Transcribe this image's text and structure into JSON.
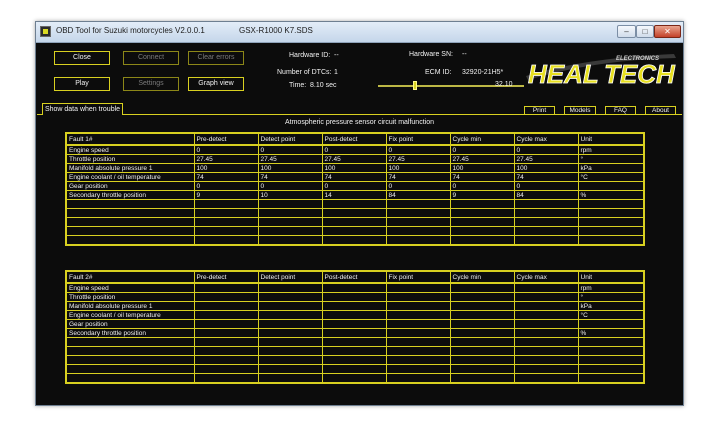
{
  "window": {
    "title": "OBD Tool for Suzuki motorcycles V2.0.0.1",
    "file": "GSX-R1000 K7.SDS",
    "minimize_glyph": "–",
    "maximize_glyph": "□",
    "close_glyph": "✕"
  },
  "toolbar": {
    "close": "Close",
    "connect": "Connect",
    "clear_errors": "Clear errors",
    "play": "Play",
    "settings": "Settings",
    "graph_view": "Graph view"
  },
  "info": {
    "hardware_id_label": "Hardware ID:",
    "hardware_id_value": "--",
    "hardware_sn_label": "Hardware SN:",
    "hardware_sn_value": "--",
    "dtc_label": "Number of DTCs:",
    "dtc_value": "1",
    "ecm_label": "ECM ID:",
    "ecm_value": "32920-21H5*",
    "time_label": "Time:",
    "time_value": "8.10 sec",
    "time_max": "32.10",
    "time_position": 0.25
  },
  "logo": {
    "text_heal": "HEAL",
    "text_tech": "TECH",
    "text_electronics": "ELECTRONICS",
    "color_main": "#e7e020"
  },
  "tabs": {
    "active": "Show data when trouble",
    "print": "Print",
    "models": "Models",
    "faq": "FAQ",
    "about": "About"
  },
  "heading": "Atmospheric pressure sensor circuit malfunction",
  "columns": [
    "Pre-detect",
    "Detect point",
    "Post-detect",
    "Fix point",
    "Cycle min",
    "Cycle max",
    "Unit"
  ],
  "fault1": {
    "label": "Fault 1#",
    "rows": [
      [
        "Engine speed",
        "0",
        "0",
        "0",
        "0",
        "0",
        "0",
        "rpm"
      ],
      [
        "Throttle position",
        "27.45",
        "27.45",
        "27.45",
        "27.45",
        "27.45",
        "27.45",
        "°"
      ],
      [
        "Manifold absolute pressure 1",
        "100",
        "100",
        "100",
        "100",
        "100",
        "100",
        "kPa"
      ],
      [
        "Engine coolant / oil temperature",
        "74",
        "74",
        "74",
        "74",
        "74",
        "74",
        "°C"
      ],
      [
        "Gear position",
        "0",
        "0",
        "0",
        "0",
        "0",
        "0",
        ""
      ],
      [
        "Secondary throttle position",
        "9",
        "10",
        "14",
        "84",
        "9",
        "84",
        "%"
      ],
      [
        "",
        "",
        "",
        "",
        "",
        "",
        "",
        ""
      ],
      [
        "",
        "",
        "",
        "",
        "",
        "",
        "",
        ""
      ],
      [
        "",
        "",
        "",
        "",
        "",
        "",
        "",
        ""
      ],
      [
        "",
        "",
        "",
        "",
        "",
        "",
        "",
        ""
      ],
      [
        "",
        "",
        "",
        "",
        "",
        "",
        "",
        ""
      ]
    ]
  },
  "fault2": {
    "label": "Fault 2#",
    "rows": [
      [
        "Engine speed",
        "",
        "",
        "",
        "",
        "",
        "",
        "rpm"
      ],
      [
        "Throttle position",
        "",
        "",
        "",
        "",
        "",
        "",
        "°"
      ],
      [
        "Manifold absolute pressure 1",
        "",
        "",
        "",
        "",
        "",
        "",
        "kPa"
      ],
      [
        "Engine coolant / oil temperature",
        "",
        "",
        "",
        "",
        "",
        "",
        "°C"
      ],
      [
        "Gear position",
        "",
        "",
        "",
        "",
        "",
        "",
        ""
      ],
      [
        "Secondary throttle position",
        "",
        "",
        "",
        "",
        "",
        "",
        "%"
      ],
      [
        "",
        "",
        "",
        "",
        "",
        "",
        "",
        ""
      ],
      [
        "",
        "",
        "",
        "",
        "",
        "",
        "",
        ""
      ],
      [
        "",
        "",
        "",
        "",
        "",
        "",
        "",
        ""
      ],
      [
        "",
        "",
        "",
        "",
        "",
        "",
        "",
        ""
      ],
      [
        "",
        "",
        "",
        "",
        "",
        "",
        "",
        ""
      ]
    ]
  },
  "colors": {
    "accent": "#d8d020",
    "background": "#0c0c0c",
    "text": "#f2f2f2"
  }
}
